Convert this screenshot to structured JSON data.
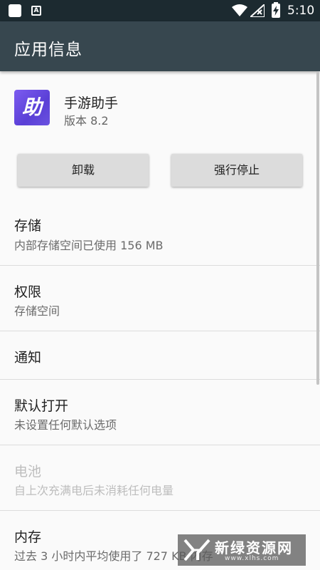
{
  "status_bar": {
    "time": "5:10",
    "notification_icon": "android-a-icon",
    "icons": [
      "square-notification-icon",
      "android-a-icon",
      "wifi-icon",
      "signal-icon",
      "battery-charging-icon"
    ]
  },
  "app_bar": {
    "title": "应用信息"
  },
  "app": {
    "name": "手游助手",
    "version": "版本 8.2",
    "icon_glyph": "助",
    "icon_colors": [
      "#7c5cf0",
      "#5a3fd6"
    ]
  },
  "buttons": {
    "uninstall": "卸载",
    "force_stop": "强行停止"
  },
  "settings": {
    "storage": {
      "title": "存储",
      "subtitle": "内部存储空间已使用 156 MB"
    },
    "permissions": {
      "title": "权限",
      "subtitle": "存储空间"
    },
    "notifications": {
      "title": "通知"
    },
    "default_open": {
      "title": "默认打开",
      "subtitle": "未设置任何默认选项"
    },
    "battery": {
      "title": "电池",
      "subtitle": "自上次充满电后未消耗任何电量"
    },
    "memory": {
      "title": "内存",
      "subtitle": "过去 3 小时内平均使用了 727 KB 内存"
    }
  },
  "watermark": {
    "text": "新绿资源网",
    "url": "www.xlhs.com"
  },
  "colors": {
    "status_bar": "#1c2a30",
    "app_bar": "#37474f",
    "background": "#fafafa",
    "button": "#dcdcdc"
  }
}
